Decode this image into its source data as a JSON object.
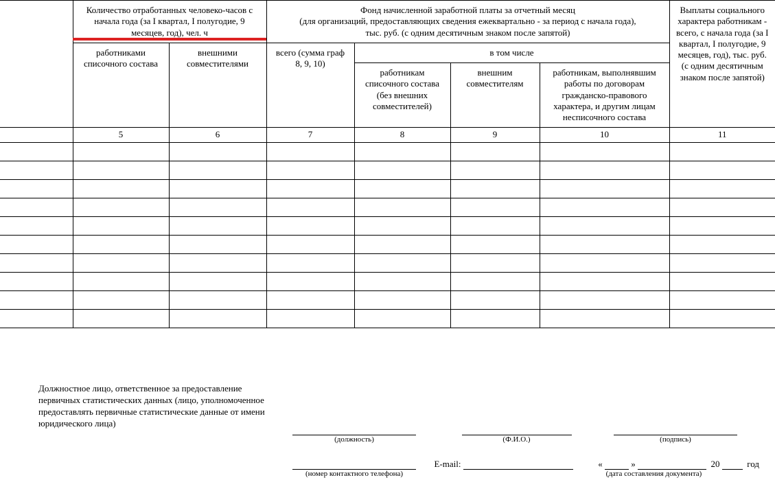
{
  "header": {
    "col_group_a": "Количество отработанных человеко-часов с начала года (за I квартал, I полугодие, 9 месяцев, год), чел. ч",
    "col_group_a_sub1": "работниками списочного состава",
    "col_group_a_sub2": "внешними совместителями",
    "col_group_b": "Фонд начисленной заработной платы за отчетный месяц\n(для организаций, предоставляющих сведения ежеквартально - за период с начала года),\nтыс. руб. (с одним десятичным знаком после запятой)",
    "col_group_b_sub1": "всего (сумма граф 8, 9, 10)",
    "col_group_b_sub2": "в том числе",
    "col_group_b_sub2a": "работникам списочного состава (без внешних совместителей)",
    "col_group_b_sub2b": "внешним совместителям",
    "col_group_b_sub2c": "работникам, выполнявшим работы по договорам гражданско-правового характера, и другим лицам несписочного состава",
    "col_group_c": "Выплаты социального характера работникам - всего, с начала года (за I квартал, I полугодие, 9 месяцев, год), тыс. руб. (с одним десятичным знаком после запятой)"
  },
  "col_numbers": [
    "5",
    "6",
    "7",
    "8",
    "9",
    "10",
    "11"
  ],
  "footer": {
    "intro": "Должностное лицо, ответственное за предоставление первичных статистических данных (лицо, уполномоченное предоставлять первичные статистические данные от имени юридического лица)",
    "position": "(должность)",
    "fio": "(Ф.И.О.)",
    "signature": "(подпись)",
    "phone": "(номер контактного телефона)",
    "email_label": "E-mail:",
    "date_open": "«",
    "date_close": "»",
    "date_year_prefix": "20",
    "date_year_suffix": "год",
    "doc_date": "(дата составления документа)"
  }
}
